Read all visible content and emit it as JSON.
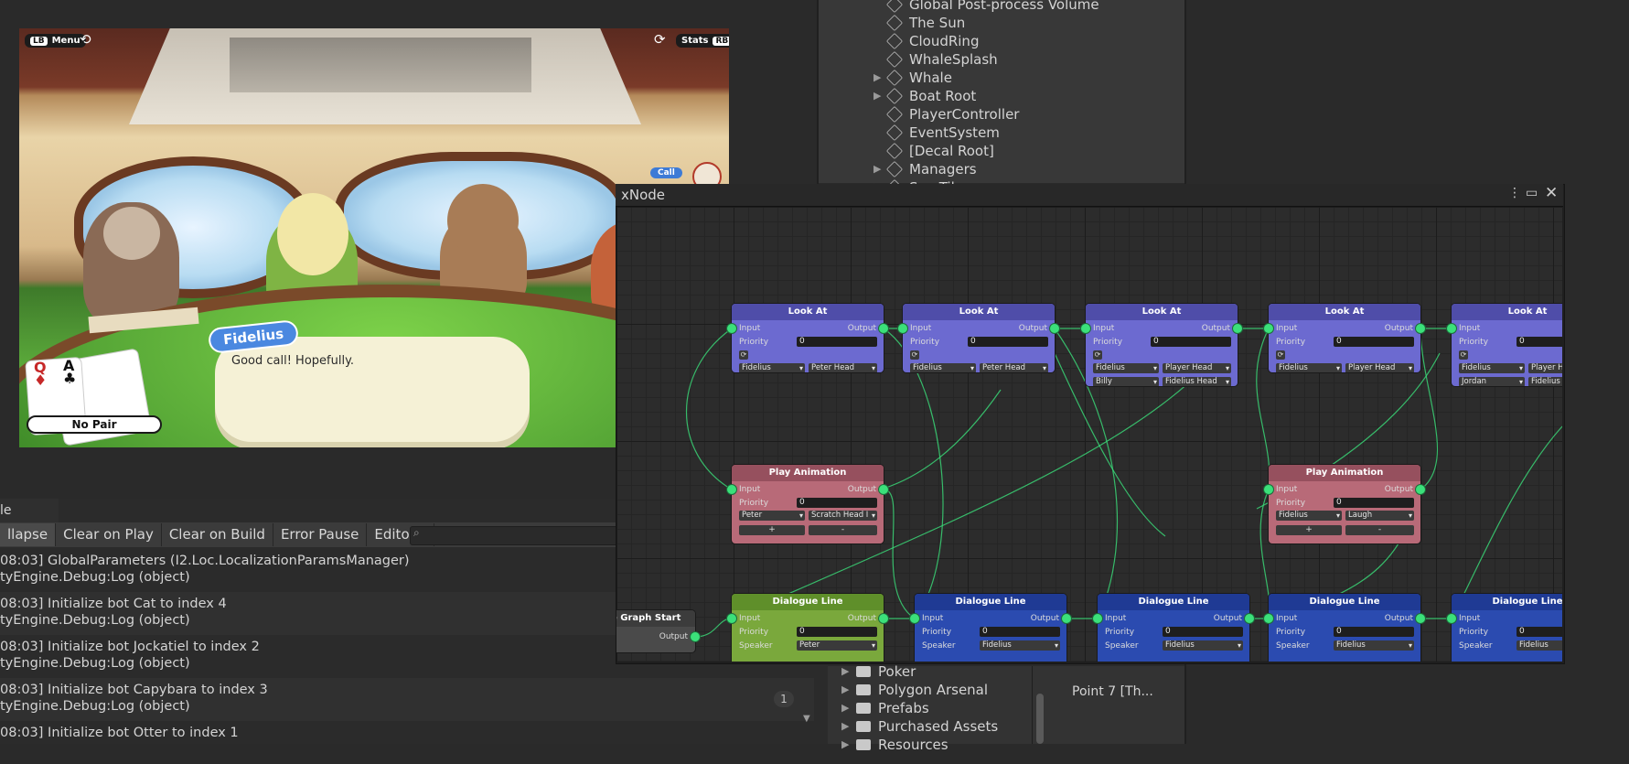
{
  "game_view": {
    "menu_key": "LB",
    "menu_label": "Menu",
    "stats_label": "Stats",
    "stats_key": "RB",
    "call_label": "Call",
    "speaker": "Fidelius",
    "dialogue": "Good call! Hopefully.",
    "card1_rank": "Q",
    "card2_rank": "A",
    "hand_result": "No Pair"
  },
  "hierarchy": {
    "items": [
      {
        "label": "Global Post-process Volume",
        "expandable": false
      },
      {
        "label": "The Sun",
        "expandable": false
      },
      {
        "label": "CloudRing",
        "expandable": false
      },
      {
        "label": "WhaleSplash",
        "expandable": false
      },
      {
        "label": "Whale",
        "expandable": true
      },
      {
        "label": "Boat Root",
        "expandable": true
      },
      {
        "label": "PlayerController",
        "expandable": false
      },
      {
        "label": "EventSystem",
        "expandable": false
      },
      {
        "label": "[Decal Root]",
        "expandable": false
      },
      {
        "label": "Managers",
        "expandable": true
      },
      {
        "label": "Sea Tiles",
        "expandable": true
      }
    ]
  },
  "console": {
    "tab_label": "le",
    "toolbar": {
      "collapse": "llapse",
      "clear_on_play": "Clear on Play",
      "clear_on_build": "Clear on Build",
      "error_pause": "Error Pause",
      "editor": "Editor"
    },
    "logs": [
      {
        "line1": "08:03] GlobalParameters (I2.Loc.LocalizationParamsManager)",
        "line2": "tyEngine.Debug:Log (object)"
      },
      {
        "line1": "08:03] Initialize bot Cat to index 4",
        "line2": "tyEngine.Debug:Log (object)"
      },
      {
        "line1": "08:03] Initialize bot Jockatiel to index 2",
        "line2": "tyEngine.Debug:Log (object)"
      },
      {
        "line1": "08:03] Initialize bot Capybara to index 3",
        "line2": "tyEngine.Debug:Log (object)"
      },
      {
        "line1": "08:03] Initialize bot Otter to index 1",
        "line2": ""
      }
    ],
    "collapse_count": "1"
  },
  "project": {
    "folders": [
      "Poker",
      "Polygon Arsenal",
      "Prefabs",
      "Purchased Assets",
      "Resources"
    ],
    "asset_label": "Point 7 [Th..."
  },
  "xnode": {
    "title": "xNode",
    "graph_start": {
      "title": "e Graph Start",
      "output": "Output"
    },
    "look_at_nodes": [
      {
        "title": "Look At",
        "input": "Input",
        "output": "Output",
        "priority_label": "Priority",
        "priority": "0",
        "rows": [
          [
            "Fidelius",
            "Peter Head"
          ]
        ]
      },
      {
        "title": "Look At",
        "input": "Input",
        "output": "Output",
        "priority_label": "Priority",
        "priority": "0",
        "rows": [
          [
            "Fidelius",
            "Peter Head"
          ]
        ]
      },
      {
        "title": "Look At",
        "input": "Input",
        "output": "Output",
        "priority_label": "Priority",
        "priority": "0",
        "rows": [
          [
            "Fidelius",
            "Player Head"
          ],
          [
            "Billy",
            "Fidelius Head"
          ]
        ]
      },
      {
        "title": "Look At",
        "input": "Input",
        "output": "Output",
        "priority_label": "Priority",
        "priority": "0",
        "rows": [
          [
            "Fidelius",
            "Player Head"
          ]
        ]
      },
      {
        "title": "Look At",
        "input": "Input",
        "output": "Output",
        "priority_label": "Priority",
        "priority": "0",
        "rows": [
          [
            "Fidelius",
            "Player H"
          ],
          [
            "Jordan",
            "Fidelius"
          ]
        ]
      }
    ],
    "anim_nodes": [
      {
        "title": "Play Animation",
        "input": "Input",
        "output": "Output",
        "priority_label": "Priority",
        "priority": "0",
        "rows": [
          [
            "Peter",
            "Scratch Head I"
          ]
        ]
      },
      {
        "title": "Play Animation",
        "input": "Input",
        "output": "Output",
        "priority_label": "Priority",
        "priority": "0",
        "rows": [
          [
            "Fidelius",
            "Laugh"
          ]
        ]
      }
    ],
    "dialogue_nodes": [
      {
        "title": "Dialogue Line",
        "input": "Input",
        "output": "Output",
        "priority_label": "Priority",
        "priority": "0",
        "speaker_label": "Speaker",
        "speaker": "Peter"
      },
      {
        "title": "Dialogue Line",
        "input": "Input",
        "output": "Output",
        "priority_label": "Priority",
        "priority": "0",
        "speaker_label": "Speaker",
        "speaker": "Fidelius"
      },
      {
        "title": "Dialogue Line",
        "input": "Input",
        "output": "Output",
        "priority_label": "Priority",
        "priority": "0",
        "speaker_label": "Speaker",
        "speaker": "Fidelius"
      },
      {
        "title": "Dialogue Line",
        "input": "Input",
        "output": "Output",
        "priority_label": "Priority",
        "priority": "0",
        "speaker_label": "Speaker",
        "speaker": "Fidelius"
      },
      {
        "title": "Dialogue Line",
        "input": "Input",
        "output": "Output",
        "priority_label": "Priority",
        "priority": "0",
        "speaker_label": "Speaker",
        "speaker": "Fidelius"
      }
    ],
    "button_plus": "+",
    "button_minus": "-"
  },
  "colors": {
    "look_at": "#6c6ad0",
    "play_animation": "#b86a78",
    "dialogue_line": "#2b4bb0",
    "dialogue_peter": "#7aa83c",
    "port": "#3be07a"
  }
}
